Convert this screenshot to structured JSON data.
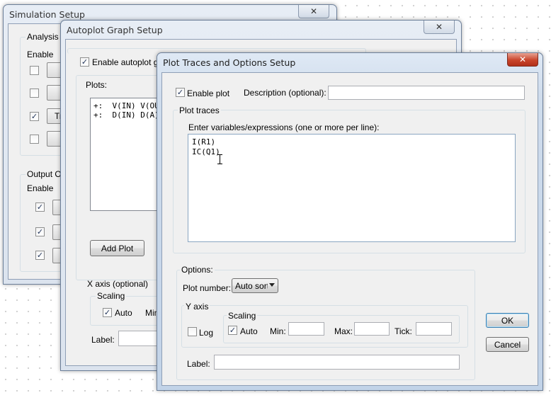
{
  "simulation_setup": {
    "title": "Simulation Setup",
    "analysis_group": "Analysis C",
    "enable_label": "Enable",
    "analysis_checks": [
      false,
      false,
      true,
      false
    ],
    "analysis_button_partial": "Tr",
    "output_group": "Output Op",
    "output_enable_label": "Enable",
    "output_checks": [
      true,
      true,
      true
    ]
  },
  "autoplot_setup": {
    "title": "Autoplot Graph Setup",
    "enable_label": "Enable autoplot gra",
    "enable_checked": true,
    "plots_label": "Plots:",
    "plots": [
      "+:  V(IN) V(OUT)",
      "+:  D(IN) D(A)"
    ],
    "add_plot": "Add Plot",
    "xaxis_label": "X axis (optional)",
    "scaling_label": "Scaling",
    "auto_label": "Auto",
    "auto_checked": true,
    "min_partial": "Min",
    "label_label": "Label:"
  },
  "plot_traces": {
    "title": "Plot Traces and Options Setup",
    "close_glyph": "✕",
    "enable_plot": "Enable plot",
    "enable_checked": true,
    "description_label": "Description (optional):",
    "description_value": "",
    "traces_group": "Plot traces",
    "traces_prompt": "Enter variables/expressions (one or more per line):",
    "traces_text": "I(R1)\nIC(Q1)",
    "options_group": "Options:",
    "plot_number_label": "Plot number:",
    "plot_number_value": "Auto sort",
    "y_axis_label": "Y axis",
    "log_label": "Log",
    "log_checked": false,
    "scaling_label": "Scaling",
    "auto_label": "Auto",
    "auto_checked": true,
    "min_label": "Min:",
    "max_label": "Max:",
    "tick_label": "Tick:",
    "min_value": "",
    "max_value": "",
    "tick_value": "",
    "label_label": "Label:",
    "label_value": "",
    "ok": "OK",
    "cancel": "Cancel"
  },
  "icons": {
    "check": "✓",
    "close": "✕"
  }
}
